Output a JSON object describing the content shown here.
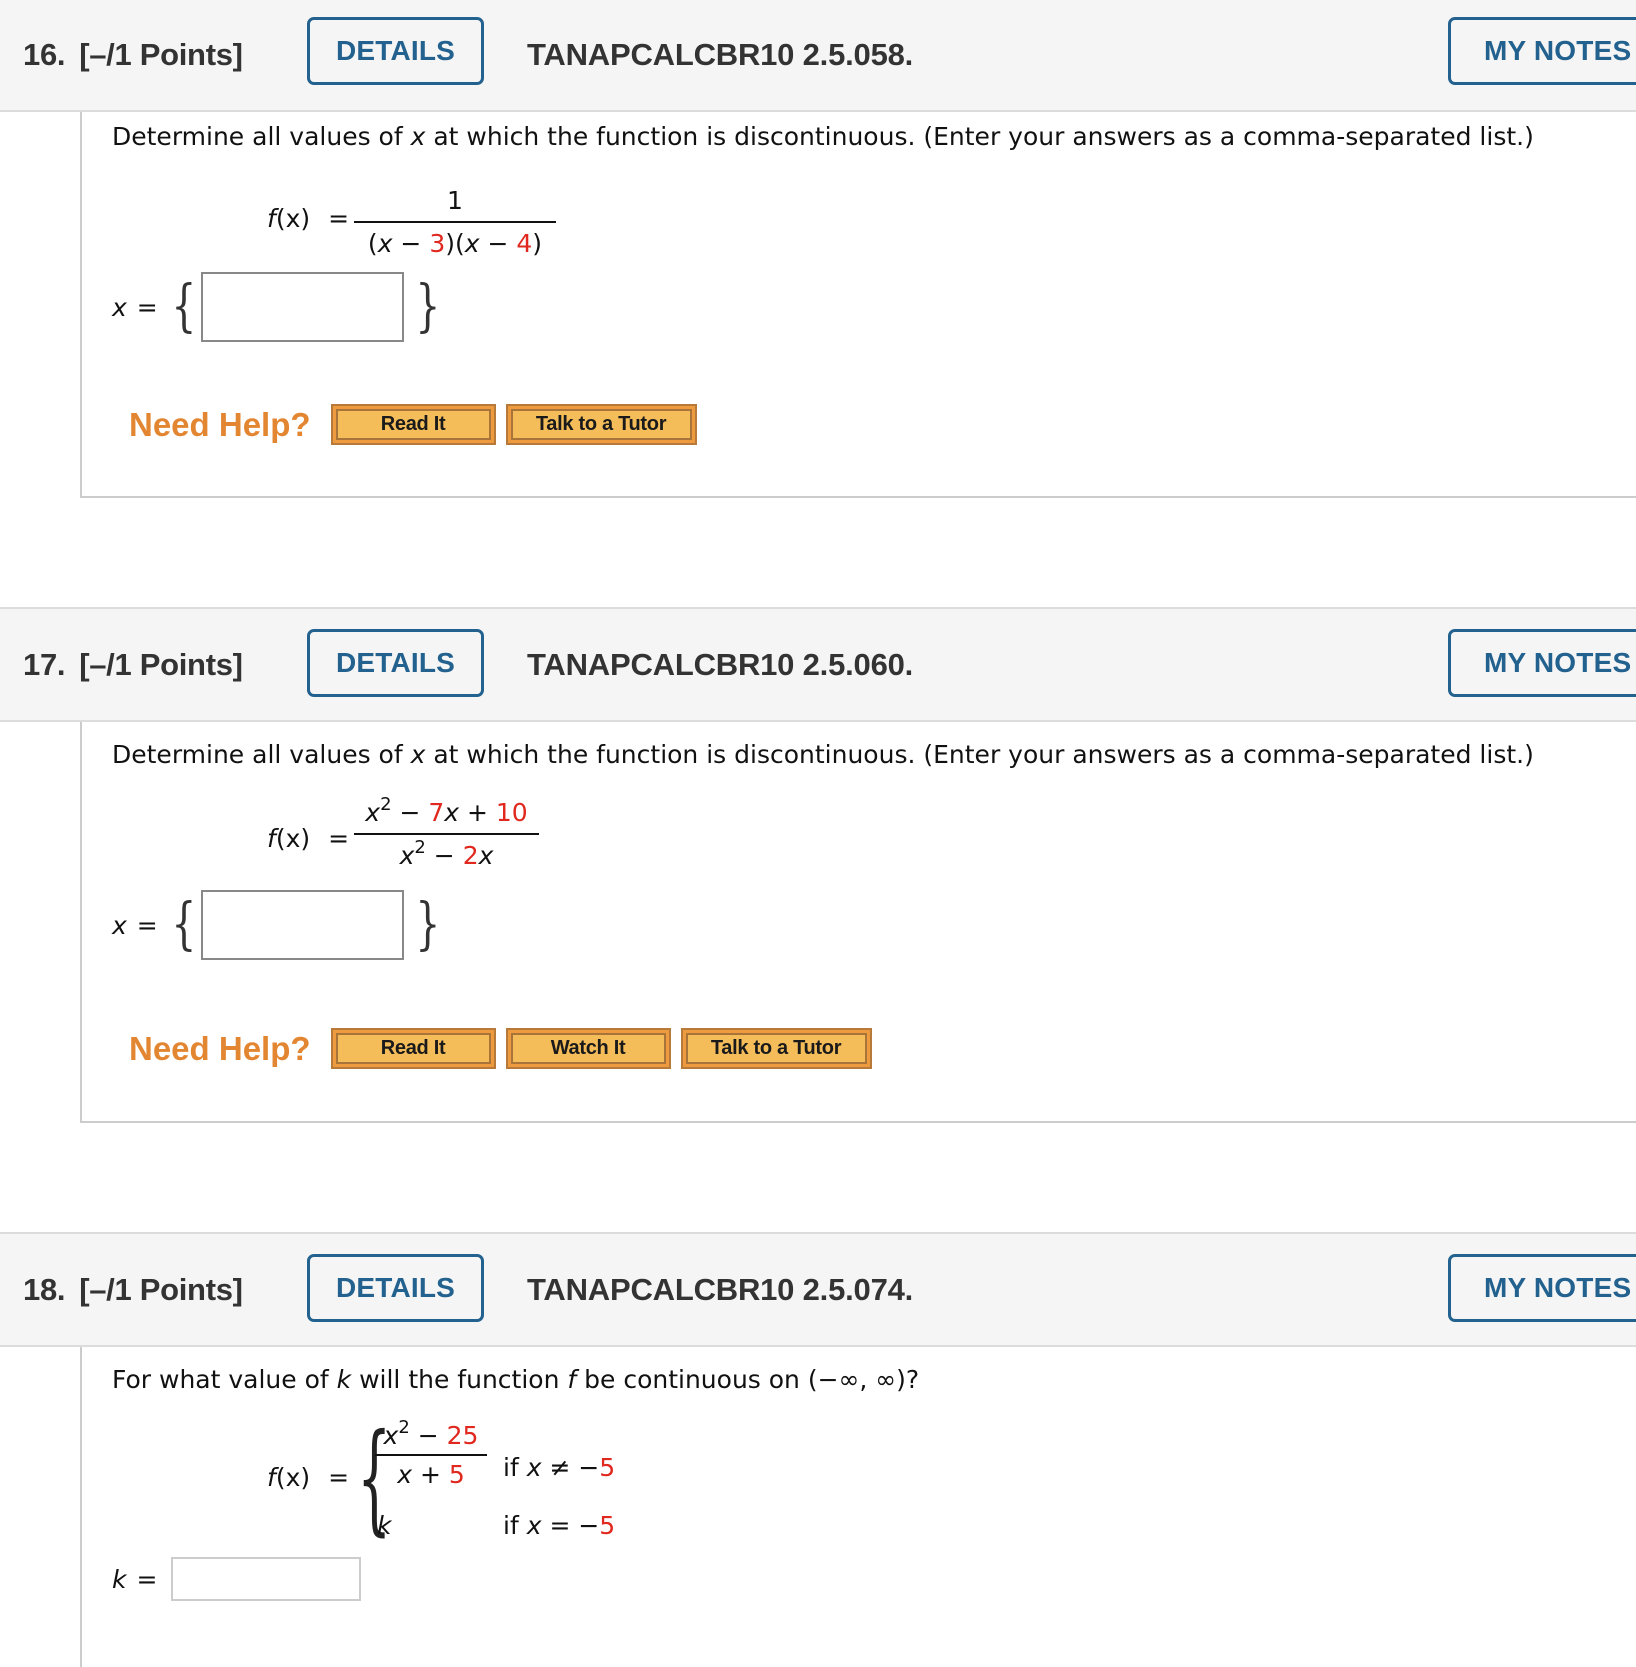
{
  "questions": [
    {
      "number": "16.",
      "points": "[–/1 Points]",
      "details_label": "DETAILS",
      "code": "TANAPCALCBR10 2.5.058.",
      "my_notes_label": "MY NOTES",
      "prompt_before": "Determine all values of ",
      "prompt_var": "x",
      "prompt_after": " at which the function is discontinuous. (Enter your answers as a comma-separated list.)",
      "function_lhs_f": "f",
      "function_lhs_rest": "(x)",
      "equals": "=",
      "numerator": "1",
      "denominator_parts": [
        "(",
        "x",
        " − ",
        "3",
        ")(",
        "x",
        " − ",
        "4",
        ")"
      ],
      "answer_var": "x",
      "answer_value": "",
      "need_help_label": "Need Help?",
      "help_buttons": [
        "Read It",
        "Talk to a Tutor"
      ]
    },
    {
      "number": "17.",
      "points": "[–/1 Points]",
      "details_label": "DETAILS",
      "code": "TANAPCALCBR10 2.5.060.",
      "my_notes_label": "MY NOTES",
      "prompt_before": "Determine all values of ",
      "prompt_var": "x",
      "prompt_after": " at which the function is discontinuous. (Enter your answers as a comma-separated list.)",
      "function_lhs_f": "f",
      "function_lhs_rest": "(x)",
      "equals": "=",
      "numerator": {
        "var": "x",
        "exp": "2",
        "op1": " − ",
        "c1": "7",
        "var2": "x",
        "op2": " + ",
        "c2": "10"
      },
      "denominator": {
        "var": "x",
        "exp": "2",
        "op1": " − ",
        "c1": "2",
        "var2": "x"
      },
      "answer_var": "x",
      "answer_value": "",
      "need_help_label": "Need Help?",
      "help_buttons": [
        "Read It",
        "Watch It",
        "Talk to a Tutor"
      ]
    },
    {
      "number": "18.",
      "points": "[–/1 Points]",
      "details_label": "DETAILS",
      "code": "TANAPCALCBR10 2.5.074.",
      "my_notes_label": "MY NOTES",
      "prompt_p1": "For what value of ",
      "prompt_k": "k",
      "prompt_p2": " will the function ",
      "prompt_f": "f",
      "prompt_p3": " be continuous on (−∞, ∞)?",
      "function_lhs_f": "f",
      "function_lhs_rest": "(x)",
      "equals": "=",
      "case1_numerator": {
        "var": "x",
        "exp": "2",
        "op": " − ",
        "c": "25"
      },
      "case1_denominator": {
        "var": "x",
        "op": " + ",
        "c": "5"
      },
      "case1_condition": {
        "pre": "if ",
        "var": "x",
        "rel": " ≠ −",
        "c": "5"
      },
      "case2_value": "k",
      "case2_condition": {
        "pre": "if ",
        "var": "x",
        "rel": " = −",
        "c": "5"
      },
      "answer_var": "k",
      "answer_value": ""
    }
  ],
  "colors": {
    "accent_blue": "#23618e",
    "constant_red": "#e0281e",
    "need_help_orange": "#e38632",
    "help_button_fill": "#f4bd5a"
  }
}
